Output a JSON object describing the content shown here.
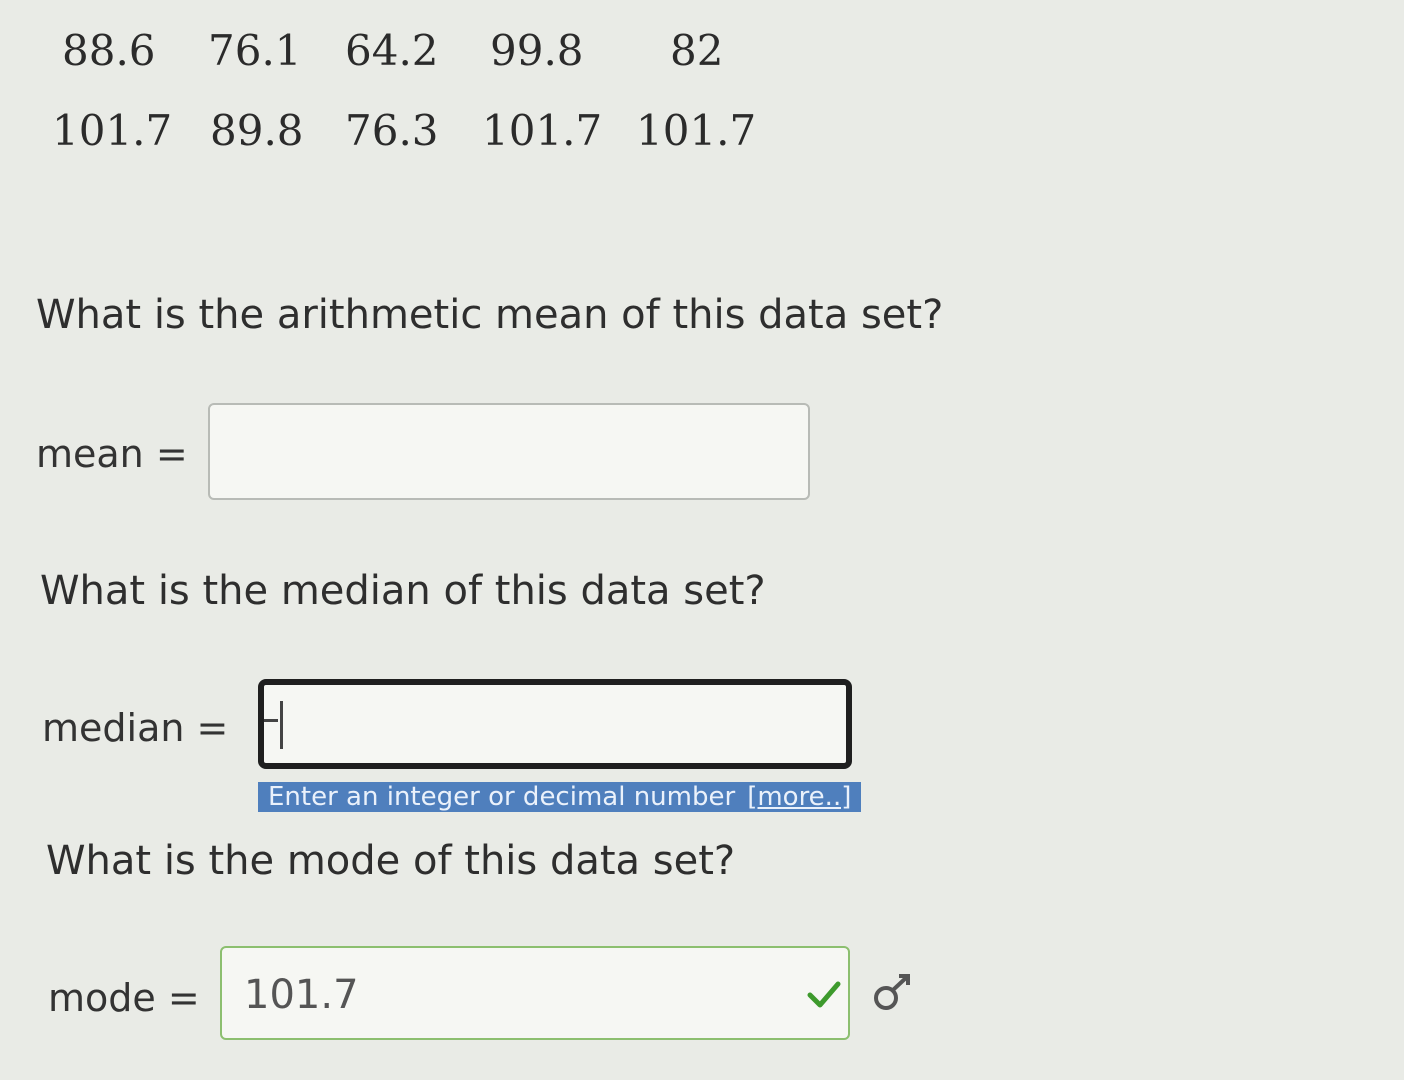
{
  "data_table": {
    "row1": [
      "88.6",
      "76.1",
      "64.2",
      "99.8",
      "82"
    ],
    "row2": [
      "101.7",
      "89.8",
      "76.3",
      "101.7",
      "101.7"
    ]
  },
  "questions": {
    "mean": "What is the arithmetic mean of this data set?",
    "median": "What is the median of this data set?",
    "mode": "What is the mode of this data set?"
  },
  "fields": {
    "mean_label": "mean =",
    "mean_value": "",
    "median_label": "median =",
    "median_value": "",
    "mode_label": "mode =",
    "mode_value": "101.7",
    "mode_status": "correct"
  },
  "hint": {
    "text": "Enter an integer or decimal number",
    "more": "[more..]"
  },
  "icons": {
    "check": "check-icon",
    "trend": "trend-icon"
  },
  "colors": {
    "background": "#e9ebe6",
    "hint_bg": "#4f7fbd",
    "correct_border": "#8cbf6f",
    "check": "#3d9a2c"
  }
}
